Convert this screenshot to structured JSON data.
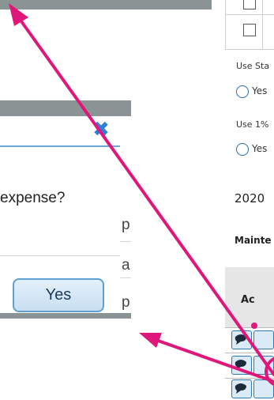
{
  "dialog": {
    "close_glyph": "✖",
    "message": "expense?",
    "yes_label": "Yes",
    "background_letters": [
      "p",
      "a",
      "p"
    ]
  },
  "page": {
    "use_standard_label": "Use Sta",
    "use_standard_option": "Yes",
    "use_one_percent_label": "Use 1%",
    "use_one_percent_option": "Yes",
    "year_heading": "2020",
    "maintenance_label": "Mainte",
    "table_header": "Ac"
  },
  "annotation": {
    "color": "#e0177a"
  },
  "icons": {
    "comment": "comment-icon",
    "close": "close-icon",
    "checkbox": "checkbox-icon",
    "radio": "radio-icon"
  }
}
